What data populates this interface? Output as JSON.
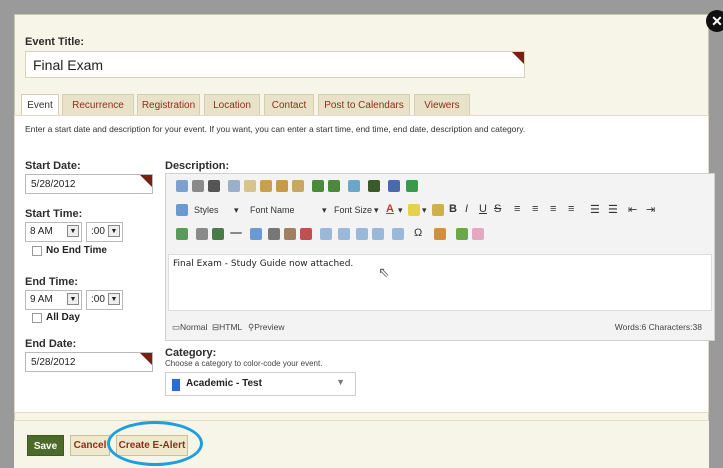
{
  "window": {
    "close_label": "✕"
  },
  "event": {
    "title_label": "Event Title:",
    "title_value": "Final Exam",
    "tabs": [
      "Event",
      "Recurrence",
      "Registration",
      "Location",
      "Contact",
      "Post to Calendars",
      "Viewers"
    ],
    "intro": "Enter a start date and description for your event. If you want, you can enter a start time, end time, end date, description and category.",
    "start_date_label": "Start Date:",
    "start_date_value": "5/28/2012",
    "start_time_label": "Start Time:",
    "start_hour": "8 AM",
    "start_min": ":00",
    "no_end_time_label": "No End Time",
    "end_time_label": "End Time:",
    "end_hour": "9 AM",
    "end_min": ":00",
    "all_day_label": "All Day",
    "end_date_label": "End Date:",
    "end_date_value": "5/28/2012",
    "description_label": "Description:",
    "description_value": "Final Exam - Study Guide now attached.",
    "category_label": "Category:",
    "category_hint": "Choose a category to color-code your event.",
    "category_value": "Academic - Test",
    "category_color": "#2b6bd6"
  },
  "editor": {
    "styles_label": "Styles",
    "font_name_label": "Font Name",
    "font_size_label": "Font Size",
    "mode_normal": "Normal",
    "mode_html": "HTML",
    "mode_preview": "Preview",
    "counter": "Words:6 Characters:38"
  },
  "actions": {
    "save": "Save",
    "cancel": "Cancel",
    "create_ealert": "Create E-Alert"
  }
}
